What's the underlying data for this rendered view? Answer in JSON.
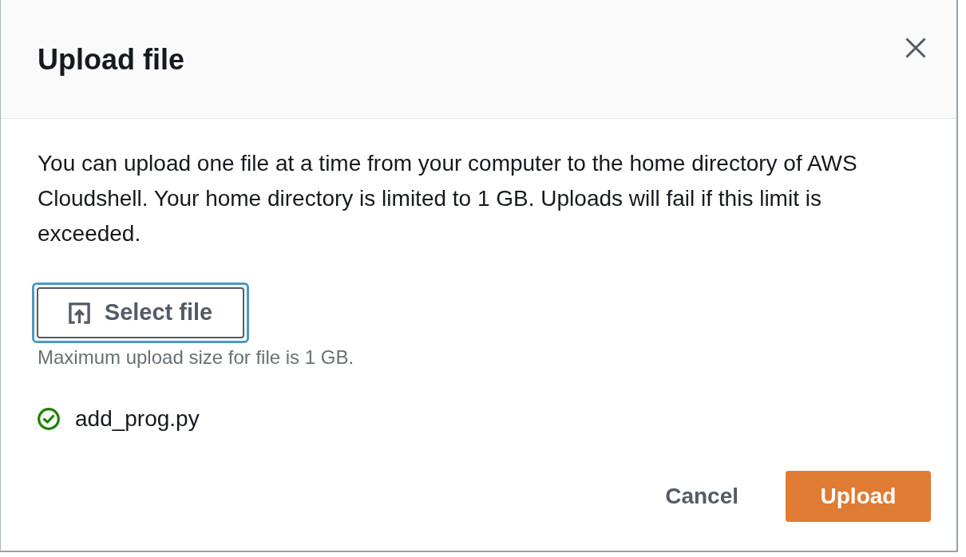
{
  "dialog": {
    "title": "Upload file",
    "description": "You can upload one file at a time from your computer to the home directory of AWS Cloudshell. Your home directory is limited to 1 GB. Uploads will fail if this limit is exceeded.",
    "select_button": {
      "label": "Select file",
      "focused": true
    },
    "hint": "Maximum upload size for file is 1 GB.",
    "files": [
      {
        "name": "add_prog.py",
        "kind": "success"
      }
    ],
    "buttons": [
      {
        "label": "Cancel",
        "kind": "link"
      },
      {
        "label": "Upload",
        "kind": "primary"
      }
    ]
  }
}
